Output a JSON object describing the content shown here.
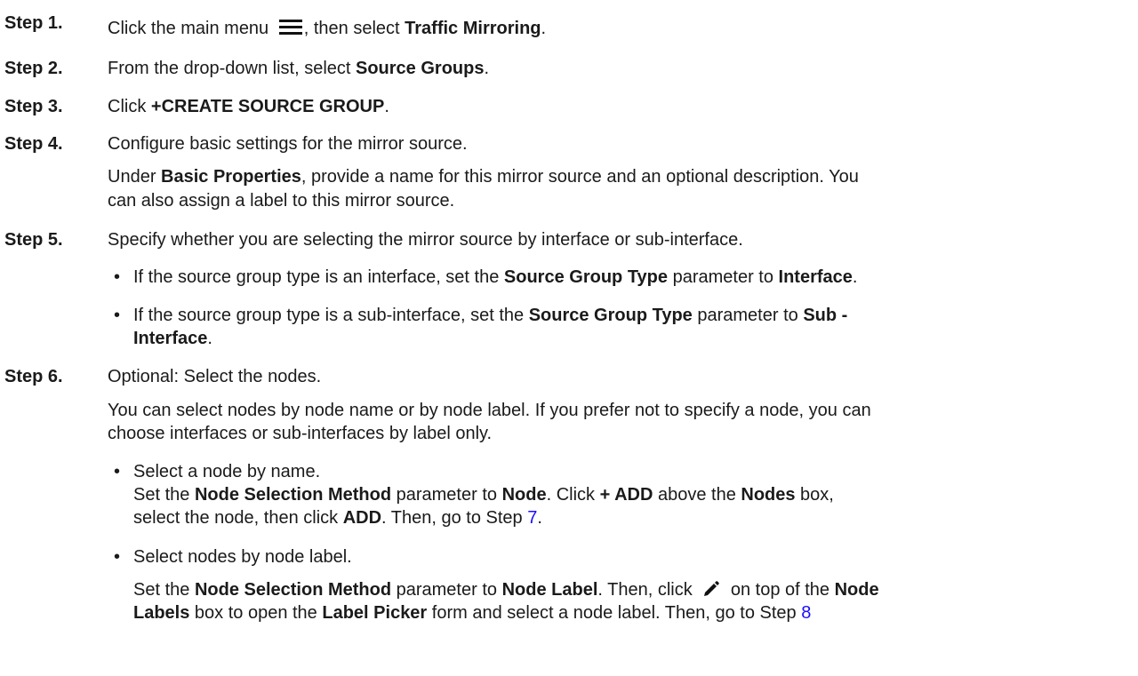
{
  "steps": [
    {
      "label": "Step 1.",
      "t1": "Click the main menu ",
      "icon": "menu-icon",
      "t2": ", then select ",
      "b1": "Traffic Mirroring",
      "t3": "."
    },
    {
      "label": "Step 2.",
      "t1": "From the drop-down list, select ",
      "b1": "Source Groups",
      "t2": "."
    },
    {
      "label": "Step 3.",
      "t1": "Click ",
      "b1": "+CREATE SOURCE GROUP",
      "t2": "."
    },
    {
      "label": "Step 4.",
      "t1": "Configure basic settings for the mirror source.",
      "p1": "Under ",
      "pb1": "Basic Properties",
      "p2": ", provide a name for this mirror source and an optional description. You",
      "p3": "can also assign a label to this mirror source."
    },
    {
      "label": "Step 5.",
      "t1": "Specify whether you are selecting the mirror source by interface or sub-interface.",
      "bullets": [
        {
          "t1": "If the source group type is an interface, set the ",
          "b1": "Source Group Type",
          "t2": " parameter to ",
          "b2": "Interface",
          "t3": "."
        },
        {
          "t1": "If the source group type is a sub-interface, set the ",
          "b1": "Source Group Type",
          "t2": " parameter to ",
          "b2": "Sub -",
          "b3": "Interface",
          "t3": "."
        }
      ]
    },
    {
      "label": "Step 6.",
      "t1": "Optional: Select the nodes.",
      "p1": "You can select nodes by node name or by node label. If you prefer not to specify a node, you can",
      "p2": "choose interfaces or sub-interfaces by label only.",
      "bullets": [
        {
          "t1": "Select a node by name.",
          "l2a": "Set the ",
          "l2b": "Node Selection Method",
          "l2c": " parameter to ",
          "l2d": "Node",
          "l2e": ". Click ",
          "l2f": "+ ADD",
          "l2g": " above the ",
          "l2h": "Nodes",
          "l2i": " box,",
          "l3a": "select the node, then click ",
          "l3b": "ADD",
          "l3c": ". Then, go to Step ",
          "l3link": "7",
          "l3d": "."
        },
        {
          "t1": "Select nodes by node label.",
          "l2a": "Set the ",
          "l2b": "Node Selection Method",
          "l2c": " parameter to ",
          "l2d": "Node Label",
          "l2e": ". Then, click ",
          "icon": "pencil-icon",
          "l2f": " on top of the ",
          "l2g": "Node",
          "l3a": "Labels",
          "l3b": " box to open the ",
          "l3c": "Label Picker",
          "l3d": " form and select a node label. Then, go to Step ",
          "l3link": "8"
        }
      ]
    }
  ]
}
